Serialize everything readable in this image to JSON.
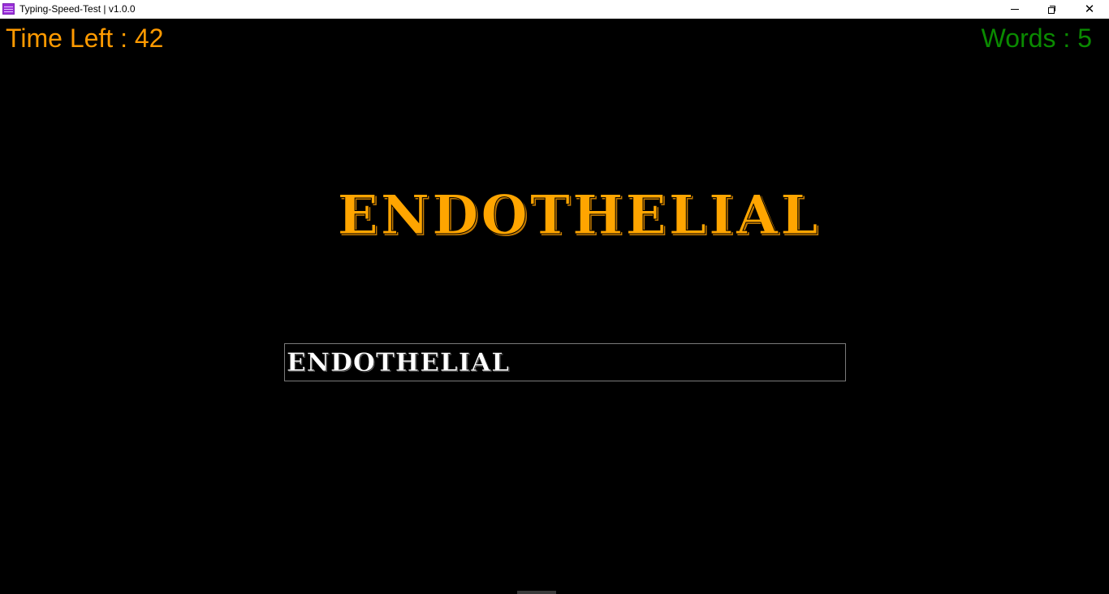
{
  "window": {
    "title": "Typing-Speed-Test | v1.0.0",
    "icon": "app-grid-icon",
    "controls": {
      "minimize_icon": "minimize-icon",
      "restore_icon": "restore-icon",
      "close_icon": "close-icon",
      "close_glyph": "✕"
    }
  },
  "status": {
    "time_left_label": "Time Left : 42",
    "time_left_value": 42,
    "words_label": "Words : 5",
    "words_value": 5
  },
  "game": {
    "target_word": "ENDOTHELIAL",
    "typed_text": "ENDOTHELIAL"
  },
  "colors": {
    "background": "#000000",
    "time_left": "#ff9a00",
    "words": "#0a8a00",
    "target_word": "#ffa500",
    "input_text": "#ffffff",
    "input_border": "#7a7a7a",
    "titlebar": "#ffffff"
  }
}
